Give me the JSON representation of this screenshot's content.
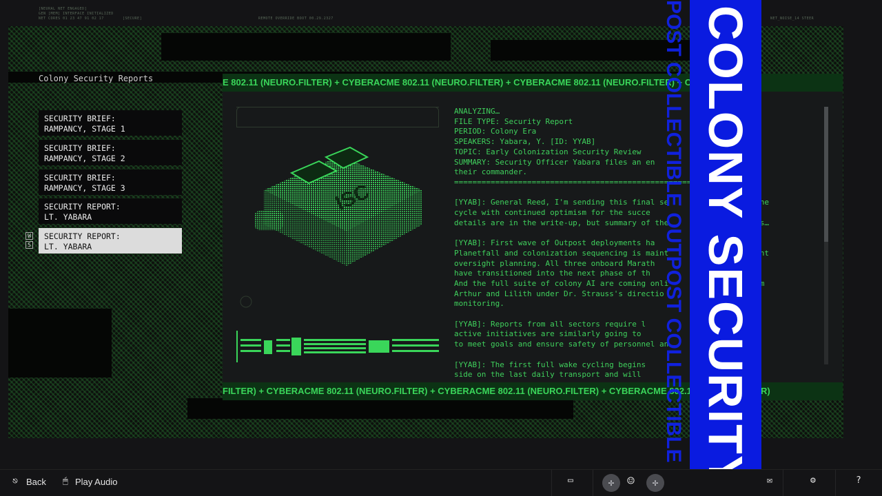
{
  "header": {
    "boot_lines": [
      "[NEURAL NET ENGAGED]",
      "GEN [MEM] INTERFACE INITIALIZED",
      "NET CORES 01 23 47 91 02 17"
    ],
    "secure_tag": "[SECURE]",
    "center_tag": "REMOTE OVERRIDE BOOT 00.29.2327",
    "right_tag": "NET_NOISE_14 STEER"
  },
  "menu": {
    "title": "Colony Security Reports",
    "items": [
      {
        "label": "SECURITY BRIEF:\nRAMPANCY, STAGE 1"
      },
      {
        "label": "SECURITY BRIEF:\nRAMPANCY, STAGE 2"
      },
      {
        "label": "SECURITY BRIEF:\nRAMPANCY, STAGE 3"
      },
      {
        "label": "SECURITY REPORT:\nLT. YABARA"
      },
      {
        "label": "SECURITY REPORT:\nLT. YABARA"
      }
    ],
    "key_hints": [
      "W",
      "S"
    ]
  },
  "ticker": {
    "top": "E 802.11 (NEURO.FILTER)   +   CYBERACME 802.11 (NEURO.FILTER)   +   CYBERACME 802.11 (NEURO.FILTER)   +   CYBE",
    "bottom": "FILTER)   +   CYBERACME 802.11 (NEURO.FILTER)   +   CYBERACME 802.11 (NEURO.FILTER)   +   CYBERACME 802.11 (NEURO.FILTER)"
  },
  "report": {
    "text": "ANALYZING…\nFILE TYPE: Security Report\nPERIOD: Colony Era\nSPEAKERS: Yabara, Y. [ID: YYAB]\nTOPIC: Early Colonization Security Review\nSUMMARY: Security Officer Yabara files an en                  to\ntheir commander.\n==================================================================\n\n[YYAB]: General Reed, I'm sending this final se               for the\ncycle with continued optimism for the succe                r. Full\ndetails are in the write-up, but summary of the              follows…\n\n[YYAB]: First wave of Outpost deployments ha                   .\nPlanetfall and colonization sequencing is maint              th joint\noversight planning. All three onboard Marath              ystems\nhave transitioned into the next phase of th              ndates.\nAnd the full suite of colony AI are coming onli              ce from\nArthur and Lilith under Dr. Strauss's directio\nmonitoring.\n\n[YYAB]: Reports from all sectors require l                t all\nactive initiatives are similarly going to                 r design\nto meet goals and ensure safety of personnel an\n\n[YYAB]: The first full wake cycling begins             ing ship-\nside on the last daily transport and will            creased"
  },
  "banner": {
    "title": "COLONY SECURITY REPORTS",
    "vertical": "POST COLLECTIBLE OUTPOST COLLECTIBLE OUTPOST COLLE"
  },
  "footer": {
    "back_label": "Back",
    "play_audio_label": "Play Audio"
  },
  "colors": {
    "accent_green": "#3fd05c",
    "banner_blue": "#0a1be0"
  }
}
